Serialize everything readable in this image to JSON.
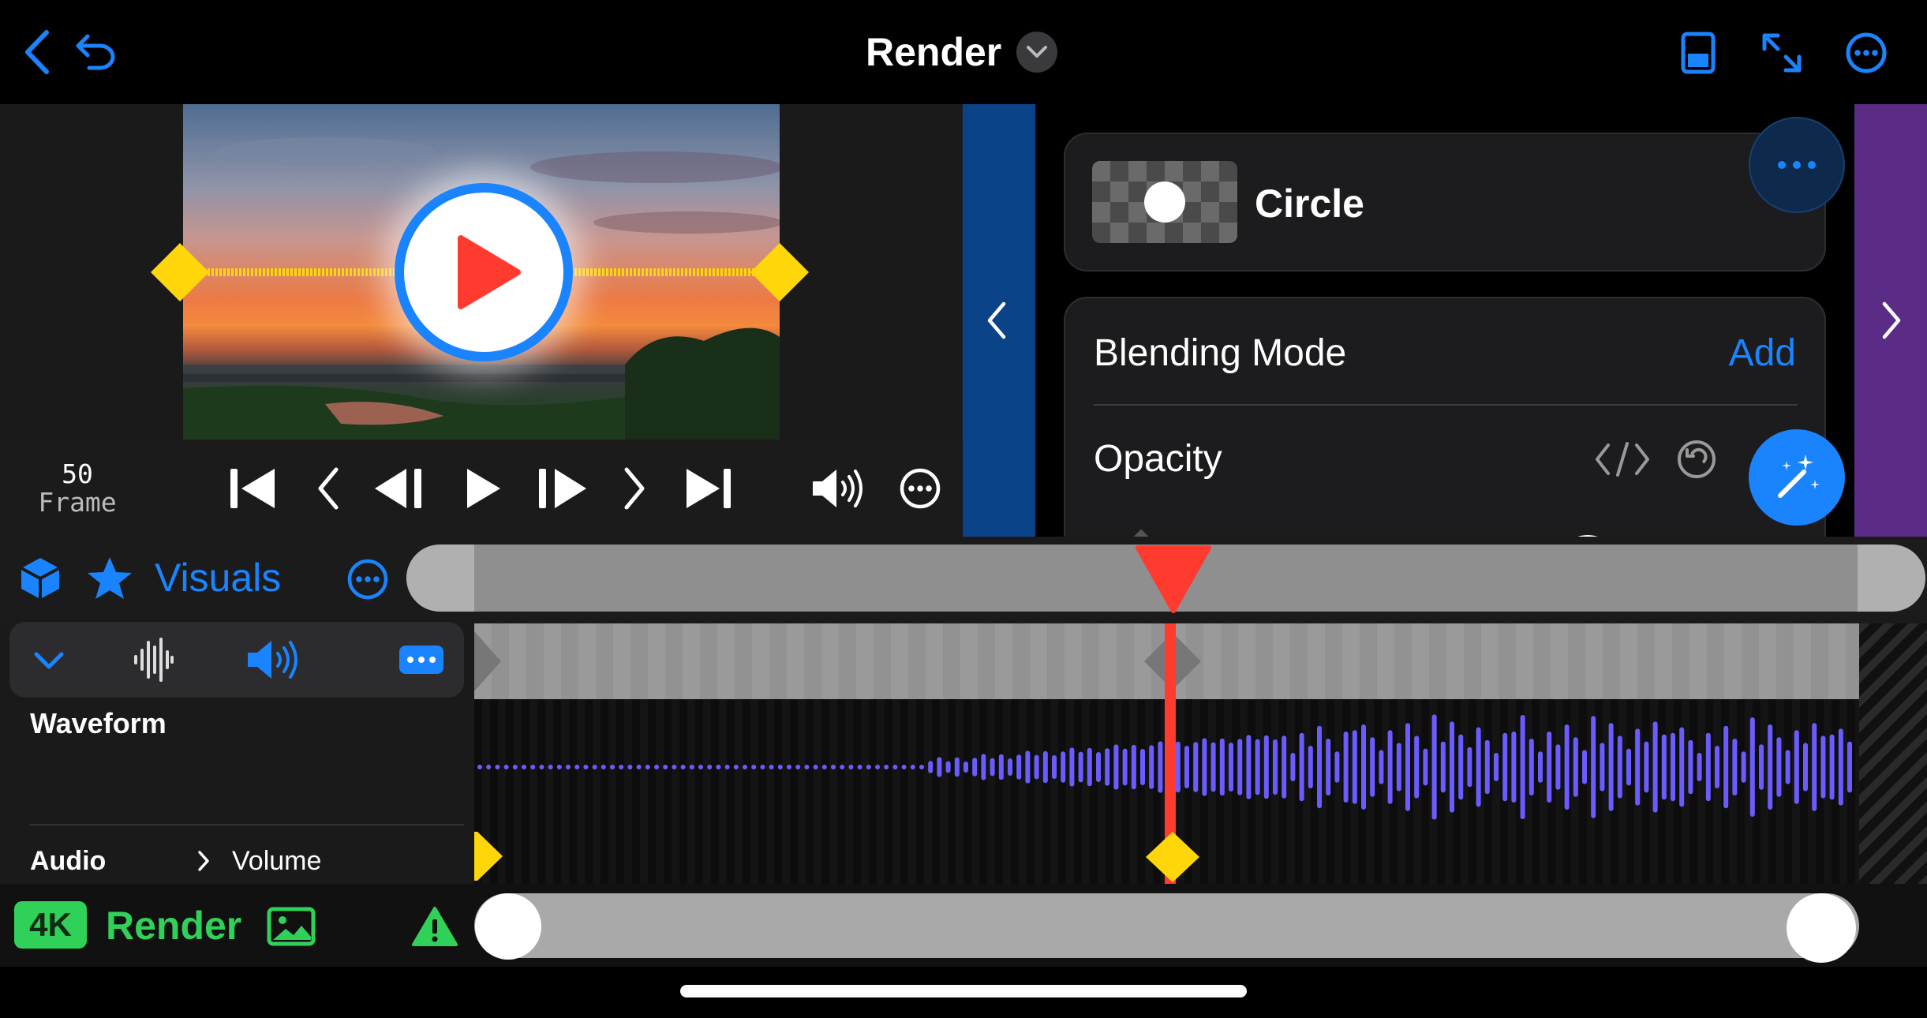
{
  "header": {
    "title": "Render",
    "accent": "#1a84ff"
  },
  "preview": {
    "frame_number": "50",
    "frame_label": "Frame"
  },
  "inspector": {
    "shape_name": "Circle",
    "blending_label": "Blending Mode",
    "blending_action": "Add",
    "opacity_label": "Opacity",
    "left_panel_color": "#0b4388",
    "right_panel_color": "#5b2c86"
  },
  "timeline": {
    "category_label": "Visuals",
    "track_name": "Waveform",
    "section_label": "Audio",
    "property_label": "Volume",
    "playhead_color": "#ff3b30",
    "wave_color": "#6b5cff",
    "keyframe_color": "#ffd60a"
  },
  "footer": {
    "resolution_badge": "4K",
    "render_label": "Render",
    "status_color": "#30d158"
  }
}
